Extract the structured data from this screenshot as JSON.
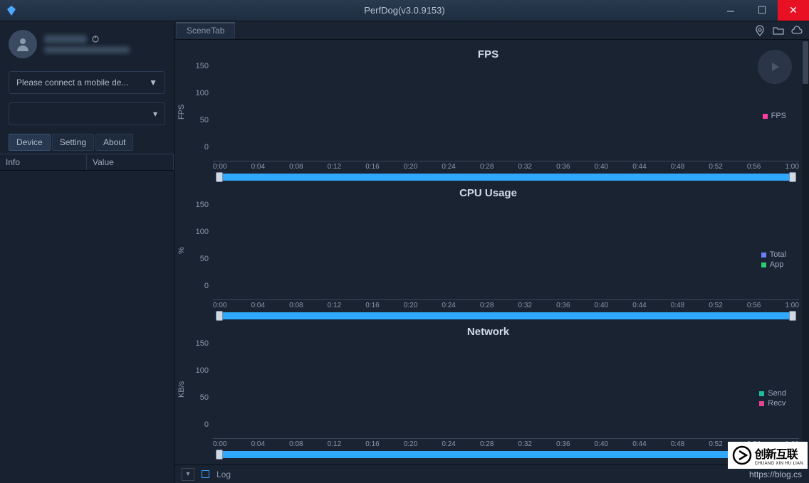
{
  "window": {
    "title": "PerfDog(v3.0.9153)"
  },
  "sidebar": {
    "device_placeholder": "Please connect a mobile de...",
    "tabs": {
      "device": "Device",
      "setting": "Setting",
      "about": "About"
    },
    "info_header": {
      "info": "Info",
      "value": "Value"
    }
  },
  "topbar": {
    "scene_tab": "SceneTab"
  },
  "footer": {
    "log": "Log",
    "link": "https://blog.cs"
  },
  "chart_data": [
    {
      "type": "line",
      "title": "FPS",
      "ylabel": "FPS",
      "ylim": [
        0,
        150
      ],
      "yticks": [
        0,
        50,
        100,
        150
      ],
      "xticks": [
        "0:00",
        "0:04",
        "0:08",
        "0:12",
        "0:16",
        "0:20",
        "0:24",
        "0:28",
        "0:32",
        "0:36",
        "0:40",
        "0:44",
        "0:48",
        "0:52",
        "0:56",
        "1:00"
      ],
      "series": [
        {
          "name": "FPS",
          "color": "#ff3ea0",
          "values": []
        }
      ]
    },
    {
      "type": "line",
      "title": "CPU Usage",
      "ylabel": "%",
      "ylim": [
        0,
        150
      ],
      "yticks": [
        0,
        50,
        100,
        150
      ],
      "xticks": [
        "0:00",
        "0:04",
        "0:08",
        "0:12",
        "0:16",
        "0:20",
        "0:24",
        "0:28",
        "0:32",
        "0:36",
        "0:40",
        "0:44",
        "0:48",
        "0:52",
        "0:56",
        "1:00"
      ],
      "series": [
        {
          "name": "Total",
          "color": "#6a7eff",
          "values": []
        },
        {
          "name": "App",
          "color": "#2ecc71",
          "values": []
        }
      ]
    },
    {
      "type": "line",
      "title": "Network",
      "ylabel": "KB/s",
      "ylim": [
        0,
        150
      ],
      "yticks": [
        0,
        50,
        100,
        150
      ],
      "xticks": [
        "0:00",
        "0:04",
        "0:08",
        "0:12",
        "0:16",
        "0:20",
        "0:24",
        "0:28",
        "0:32",
        "0:36",
        "0:40",
        "0:44",
        "0:48",
        "0:52",
        "0:56",
        "1:00"
      ],
      "series": [
        {
          "name": "Send",
          "color": "#1abc9c",
          "values": []
        },
        {
          "name": "Recv",
          "color": "#e84393",
          "values": []
        }
      ]
    }
  ],
  "watermark": {
    "main": "创新互联",
    "sub": "CHUANG XIN HU LIAN"
  }
}
